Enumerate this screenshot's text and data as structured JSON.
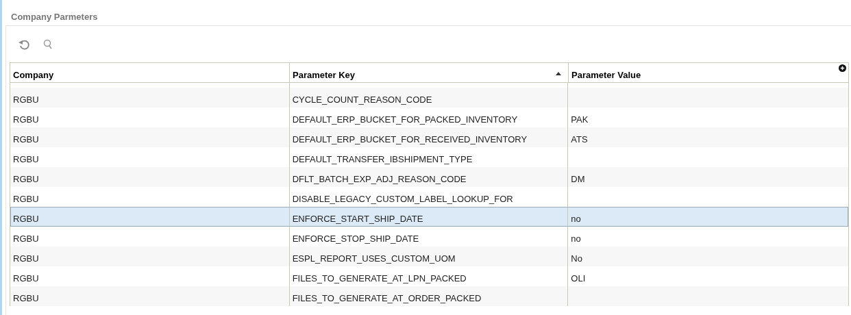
{
  "title": "Company Parmeters",
  "toolbar": [
    {
      "kind": "refresh"
    },
    {
      "kind": "search"
    }
  ],
  "table": {
    "columns": [
      {
        "label": "Company",
        "sorted": false
      },
      {
        "label": "Parameter Key",
        "sorted": true
      },
      {
        "label": "Parameter Value",
        "sorted": false
      }
    ],
    "rows": [
      {
        "cells": [
          "RGBU",
          "CYCLE_COUNT_REASON_CODE",
          ""
        ],
        "selected": false
      },
      {
        "cells": [
          "RGBU",
          "DEFAULT_ERP_BUCKET_FOR_PACKED_INVENTORY",
          "PAK"
        ],
        "selected": false
      },
      {
        "cells": [
          "RGBU",
          "DEFAULT_ERP_BUCKET_FOR_RECEIVED_INVENTORY",
          "ATS"
        ],
        "selected": false
      },
      {
        "cells": [
          "RGBU",
          "DEFAULT_TRANSFER_IBSHIPMENT_TYPE",
          ""
        ],
        "selected": false
      },
      {
        "cells": [
          "RGBU",
          "DFLT_BATCH_EXP_ADJ_REASON_CODE",
          "DM"
        ],
        "selected": false
      },
      {
        "cells": [
          "RGBU",
          "DISABLE_LEGACY_CUSTOM_LABEL_LOOKUP_FOR",
          ""
        ],
        "selected": false
      },
      {
        "cells": [
          "RGBU",
          "ENFORCE_START_SHIP_DATE",
          "no"
        ],
        "selected": true
      },
      {
        "cells": [
          "RGBU",
          "ENFORCE_STOP_SHIP_DATE",
          "no"
        ],
        "selected": false
      },
      {
        "cells": [
          "RGBU",
          "ESPL_REPORT_USES_CUSTOM_UOM",
          "No"
        ],
        "selected": false
      },
      {
        "cells": [
          "RGBU",
          "FILES_TO_GENERATE_AT_LPN_PACKED",
          "OLI"
        ],
        "selected": false
      },
      {
        "cells": [
          "RGBU",
          "FILES_TO_GENERATE_AT_ORDER_PACKED",
          ""
        ],
        "selected": false
      }
    ]
  }
}
